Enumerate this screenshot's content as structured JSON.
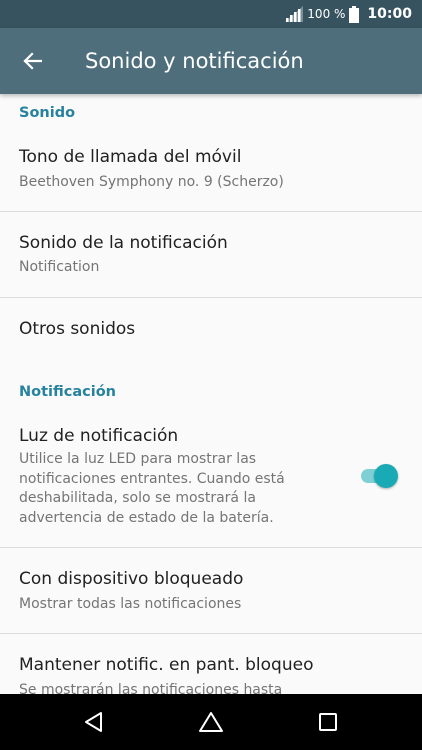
{
  "status_bar": {
    "battery_percent": "100 %",
    "time": "10:00",
    "icons": [
      "signal-icon",
      "battery-icon"
    ]
  },
  "header": {
    "title": "Sonido y notificación",
    "back_icon": "arrow-left-icon"
  },
  "sections": {
    "sound": {
      "header": "Sonido",
      "ringtone": {
        "title": "Tono de llamada del móvil",
        "subtitle": "Beethoven Symphony no. 9 (Scherzo)"
      },
      "notification_sound": {
        "title": "Sonido de la notificación",
        "subtitle": "Notification"
      },
      "other_sounds": {
        "title": "Otros sonidos"
      }
    },
    "notification": {
      "header": "Notificación",
      "led": {
        "title": "Luz de notificación",
        "description_lines": [
          "Utilice la luz LED para mostrar las",
          "notificaciones entrantes. Cuando está",
          "deshabilitada, solo se mostrará la",
          "advertencia de estado de la batería."
        ],
        "enabled": true
      },
      "locked": {
        "title": "Con dispositivo bloqueado",
        "subtitle": "Mostrar todas las notificaciones"
      },
      "keep_lock": {
        "title": "Mantener notific. en pant. bloqueo",
        "subtitle": "Se mostrarán las notificaciones hasta"
      }
    }
  },
  "colors": {
    "status_bar": "#36535f",
    "app_bar": "#4e6e7c",
    "accent": "#26829f",
    "toggle_on": "#1aaab5"
  },
  "nav_bar": {
    "icons": [
      "back-triangle-icon",
      "home-icon",
      "recents-icon"
    ]
  }
}
